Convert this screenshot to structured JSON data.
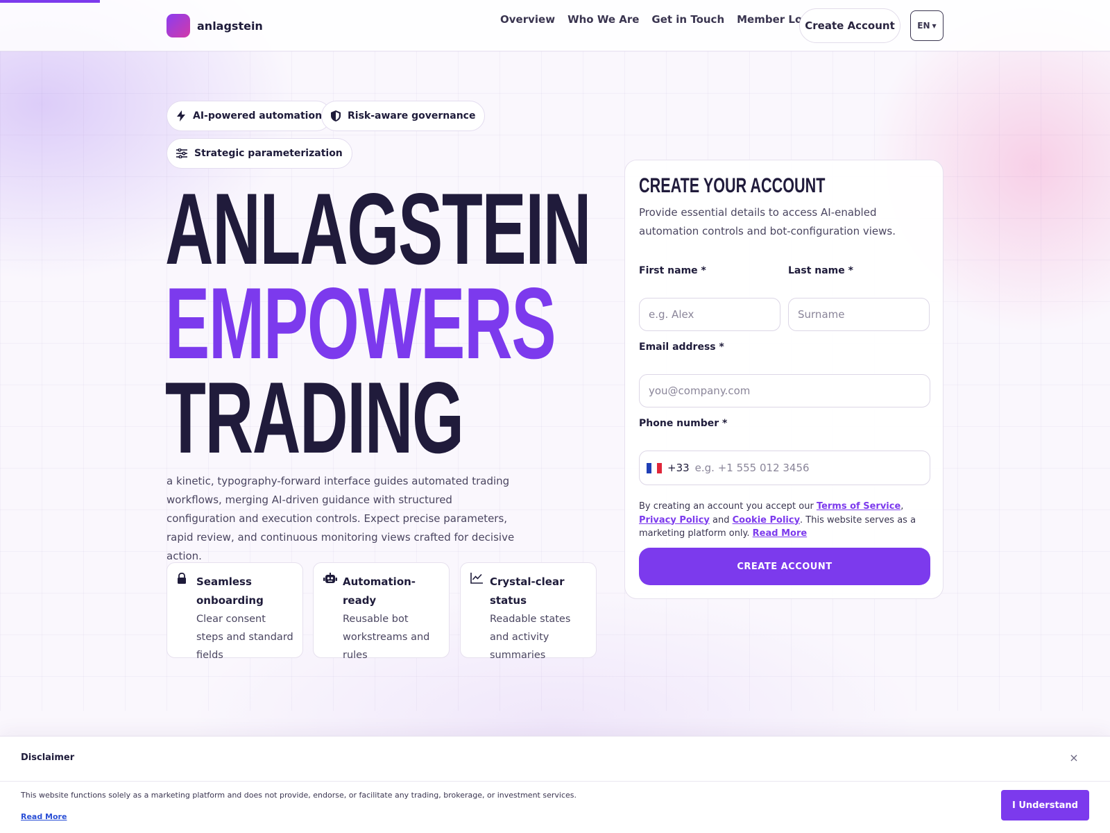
{
  "brand": {
    "name": "anlagstein"
  },
  "nav": {
    "items": [
      "Overview",
      "Who We Are",
      "Get in Touch",
      "Member Login"
    ],
    "create_account": "Create Account",
    "language": "EN"
  },
  "hero": {
    "pills": [
      "AI-powered automation",
      "Risk-aware governance",
      "Strategic parameterization"
    ],
    "headline": [
      "ANLAGSTEIN",
      "EMPOWERS",
      "TRADING"
    ],
    "intro": "a kinetic, typography-forward interface guides automated trading workflows, merging AI-driven guidance with structured configuration and execution controls. Expect precise parameters, rapid review, and continuous monitoring views crafted for decisive action.",
    "features": [
      {
        "icon": "lock-icon",
        "title": "Seamless onboarding",
        "desc": "Clear consent steps and standard fields"
      },
      {
        "icon": "robot-icon",
        "title": "Automation-ready",
        "desc": "Reusable bot workstreams and rules"
      },
      {
        "icon": "chart-line-icon",
        "title": "Crystal-clear status",
        "desc": "Readable states and activity summaries"
      }
    ]
  },
  "form": {
    "title": "CREATE YOUR ACCOUNT",
    "subtitle": "Provide essential details to access AI-enabled automation controls and bot-configuration views.",
    "first_name": {
      "label": "First name *",
      "placeholder": "e.g. Alex"
    },
    "last_name": {
      "label": "Last name *",
      "placeholder": "Surname"
    },
    "email": {
      "label": "Email address *",
      "placeholder": "you@company.com"
    },
    "phone": {
      "label": "Phone number *",
      "dial_code": "+33",
      "placeholder": "e.g. +1 555 012 3456"
    },
    "consent": {
      "prefix": "By creating an account you accept our ",
      "terms": "Terms of Service",
      "comma": ", ",
      "privacy": "Privacy Policy",
      "and": " and ",
      "cookie": "Cookie Policy",
      "suffix": ". This website serves as a marketing platform only. ",
      "read_more": "Read More"
    },
    "submit": "CREATE ACCOUNT"
  },
  "disclaimer": {
    "title": "Disclaimer",
    "close": "×",
    "text": "This website functions solely as a marketing platform and does not provide, endorse, or facilitate any trading, brokerage, or investment services.",
    "read_more": "Read More",
    "button": "I Understand"
  },
  "colors": {
    "accent": "#7c3aed",
    "ink": "#201b3b",
    "logo_gradient_start": "#8b3df0",
    "logo_gradient_end": "#d23aa8"
  }
}
